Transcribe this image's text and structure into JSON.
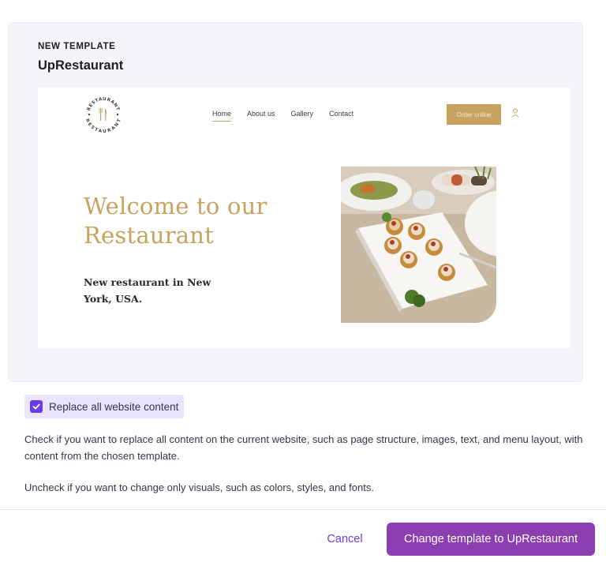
{
  "header": {
    "eyebrow": "NEW TEMPLATE",
    "template_name": "UpRestaurant"
  },
  "preview": {
    "logo": {
      "text_top": "RESTAURANT",
      "text_bottom": "RESTAURANT",
      "icon": "fork-knife-icon"
    },
    "nav": {
      "items": [
        "Home",
        "About us",
        "Gallery",
        "Contact"
      ],
      "active": "Home"
    },
    "order_button_label": "Order online",
    "user_icon": "user-icon",
    "hero": {
      "title": "Welcome to our Restaurant",
      "subtitle": "New restaurant in New York, USA."
    },
    "accent_color": "#c8a35f"
  },
  "option": {
    "checked": true,
    "label": "Replace all website content",
    "check_icon": "checkmark-icon"
  },
  "description": {
    "check_text": "Check if you want to replace all content on the current website, such as page structure, images, text, and menu layout, with content from the chosen template.",
    "uncheck_text": "Uncheck if you want to change only visuals, such as colors, styles, and fonts."
  },
  "footer": {
    "cancel_label": "Cancel",
    "confirm_label": "Change template to UpRestaurant"
  },
  "colors": {
    "primary_button": "#8c3fb0",
    "link": "#673de6",
    "checkbox": "#673de6"
  }
}
